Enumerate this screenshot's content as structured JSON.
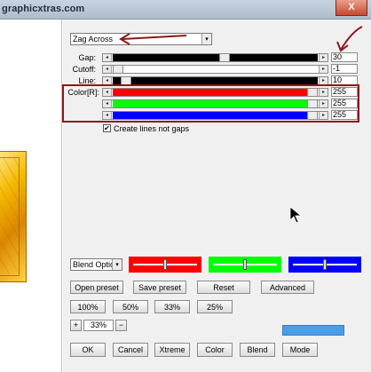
{
  "window": {
    "title": "graphicxtras.com",
    "close_label": "X"
  },
  "mode_select": {
    "value": "Zag Across",
    "arrow": "▾"
  },
  "sliders": {
    "gap": {
      "label": "Gap:",
      "value": "30",
      "level": 0.55,
      "color": "#000000"
    },
    "cutoff": {
      "label": "Cutoff:",
      "value": "-1",
      "level": 0.0,
      "color": "#8a8a8a"
    },
    "line": {
      "label": "Line:",
      "value": "10",
      "level": 0.04,
      "color": "#000000"
    },
    "red": {
      "label": "Color[R]:",
      "value": "255",
      "level": 1.0,
      "color": "#ff0000"
    },
    "green": {
      "label": "",
      "value": "255",
      "level": 1.0,
      "color": "#00ff00"
    },
    "blue": {
      "label": "",
      "value": "255",
      "level": 1.0,
      "color": "#0000ff"
    }
  },
  "create_lines": {
    "label": "Create lines not gaps",
    "checked": "✔"
  },
  "blend_select": {
    "value": "Blend Optio",
    "arrow": "▾"
  },
  "color_swatches": [
    {
      "color": "#ff0000",
      "level": 0.5
    },
    {
      "color": "#00ff00",
      "level": 0.5
    },
    {
      "color": "#0000ff",
      "level": 0.5
    }
  ],
  "buttons": {
    "open_preset": "Open preset",
    "save_preset": "Save preset",
    "reset": "Reset",
    "advanced": "Advanced",
    "zoom_100": "100%",
    "zoom_50": "50%",
    "zoom_33": "33%",
    "zoom_25": "25%",
    "zoom_plus": "+",
    "zoom_minus": "−",
    "ok": "OK",
    "cancel": "Cancel",
    "xtreme": "Xtreme",
    "color": "Color",
    "blend": "Blend",
    "mode": "Mode"
  },
  "zoom_level": "33%",
  "accent": {
    "annotation": "#8b1a1a",
    "progress": "#4a9ee8"
  }
}
